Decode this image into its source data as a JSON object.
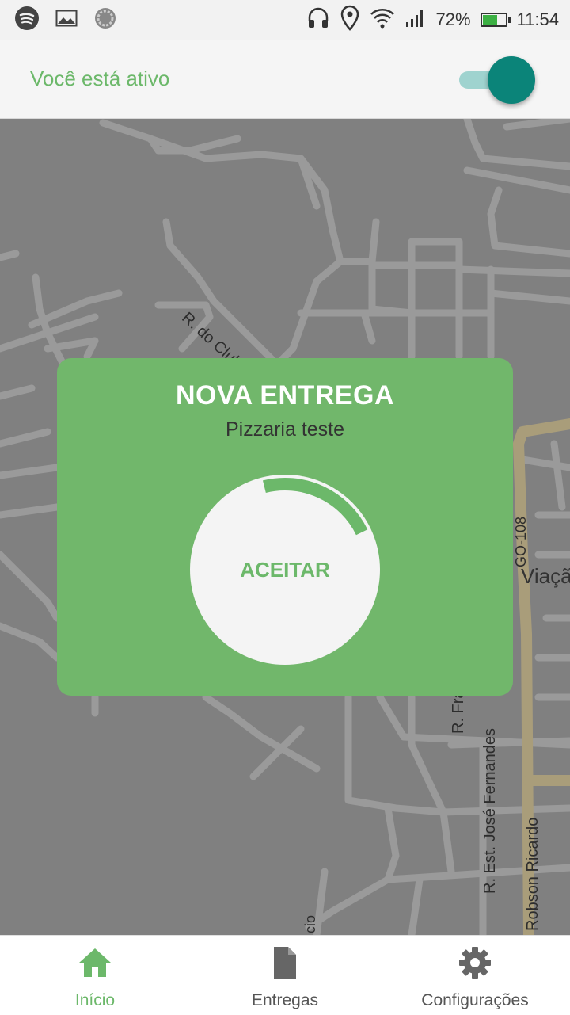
{
  "status_bar": {
    "left_icons": [
      "spotify-icon",
      "image-icon",
      "sync-icon"
    ],
    "right_icons": [
      "headphones-icon",
      "location-icon",
      "wifi-icon",
      "signal-icon"
    ],
    "battery_percent": "72%",
    "battery_level": 0.72,
    "time": "11:54"
  },
  "header": {
    "status_label": "Você está ativo",
    "active_toggle_on": true
  },
  "map": {
    "labels": {
      "street_clube": "R. do Clube",
      "road_go108": "GO-108",
      "place_viaca": "Viaçã",
      "street_fra": "R. Fra",
      "street_jose_fernandes": "R. Est. José Fernandes",
      "street_robson_ricardo": "Robson Ricardo",
      "street_cio": "cio"
    }
  },
  "delivery_card": {
    "title": "NOVA ENTREGA",
    "restaurant": "Pizzaria teste",
    "accept_label": "ACEITAR",
    "countdown_fraction": 0.1
  },
  "bottom_nav": {
    "items": [
      {
        "label": "Início",
        "icon": "home-icon",
        "active": true
      },
      {
        "label": "Entregas",
        "icon": "document-icon",
        "active": false
      },
      {
        "label": "Configurações",
        "icon": "gear-icon",
        "active": false
      }
    ]
  },
  "colors": {
    "accent_green": "#6cb86a",
    "card_green": "#71b76b",
    "toggle_teal": "#0b8479",
    "map_gray": "#808080"
  }
}
